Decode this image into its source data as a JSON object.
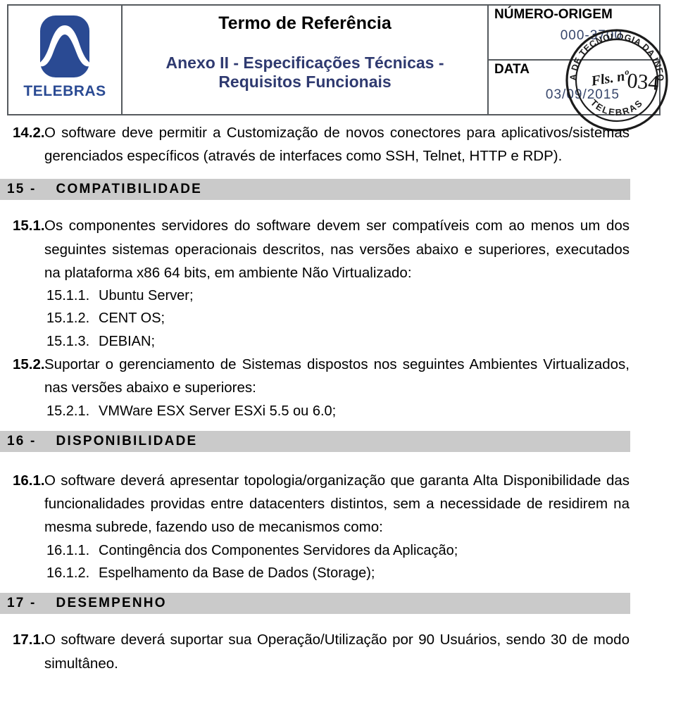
{
  "header": {
    "logo": {
      "wordmark": "TELEBRAS"
    },
    "doc_title": "Termo de Referência",
    "doc_subtitle": "Anexo II - Especificações Técnicas - Requisitos Funcionais",
    "origem_label": "NÚMERO-ORIGEM",
    "origem_value": "000-3700",
    "data_label": "DATA",
    "data_value": "03/09/2015",
    "stamp": {
      "outer_text": "GERÊNCIA DE TECNOLOGIA DA INFORMAÇÃO",
      "bottom_text": "TELEBRAS",
      "center_label": "Fls. nº",
      "center_number": "034"
    }
  },
  "body": {
    "items": [
      {
        "kind": "item1",
        "number": "14.2.",
        "text": "O software deve permitir a Customização de novos conectores para aplicativos/sistemas gerenciados específicos (através de interfaces como SSH, Telnet, HTTP e RDP)."
      },
      {
        "kind": "section",
        "number": "15 -",
        "text": "COMPATIBILIDADE"
      },
      {
        "kind": "item1",
        "number": "15.1.",
        "text": "Os componentes servidores do software devem ser compatíveis com ao menos um dos seguintes sistemas operacionais descritos, nas versões abaixo e superiores, executados na plataforma x86 64 bits, em ambiente Não Virtualizado:"
      },
      {
        "kind": "item2",
        "number": "15.1.1.",
        "text": "Ubuntu Server;"
      },
      {
        "kind": "item2",
        "number": "15.1.2.",
        "text": "CENT OS;"
      },
      {
        "kind": "item2",
        "number": "15.1.3.",
        "text": "DEBIAN;"
      },
      {
        "kind": "item1",
        "number": "15.2.",
        "text": "Suportar o gerenciamento de Sistemas dispostos nos seguintes Ambientes Virtualizados, nas versões abaixo e superiores:"
      },
      {
        "kind": "item2",
        "number": "15.2.1.",
        "text": "VMWare ESX Server ESXi 5.5 ou 6.0;"
      },
      {
        "kind": "section",
        "number": "16 -",
        "text": "DISPONIBILIDADE"
      },
      {
        "kind": "item1",
        "number": "16.1.",
        "text": "O software deverá apresentar topologia/organização que garanta Alta Disponibilidade das funcionalidades providas entre datacenters distintos, sem a necessidade de residirem na mesma subrede, fazendo uso de mecanismos como:"
      },
      {
        "kind": "item2",
        "number": "16.1.1.",
        "text": "Contingência dos Componentes Servidores da Aplicação;"
      },
      {
        "kind": "item2",
        "number": "16.1.2.",
        "text": "Espelhamento da Base de Dados (Storage);"
      },
      {
        "kind": "section",
        "number": "17 -",
        "text": "DESEMPENHO"
      },
      {
        "kind": "item1",
        "number": "17.1.",
        "text": "O software deverá suportar sua Operação/Utilização por 90 Usuários, sendo 30 de modo simultâneo."
      }
    ]
  },
  "colors": {
    "brand_blue": "#2a4a93",
    "subtitle_navy": "#2f3a70",
    "section_bar_gray": "#cacaca",
    "table_border": "#555a5e"
  }
}
